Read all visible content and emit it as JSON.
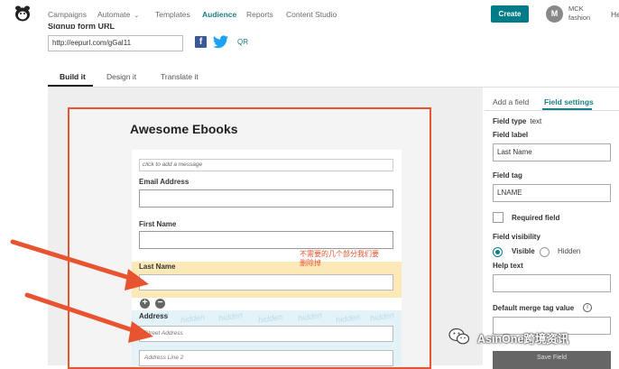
{
  "nav": {
    "items": [
      {
        "label": "Campaigns"
      },
      {
        "label": "Automate"
      },
      {
        "label": "Templates"
      },
      {
        "label": "Audience"
      },
      {
        "label": "Reports"
      },
      {
        "label": "Content Studio"
      }
    ],
    "create_label": "Create",
    "avatar_initial": "M",
    "account_line1": "MCK",
    "account_line2": "fashion",
    "help_label": "He"
  },
  "signup": {
    "title": "Signup form URL",
    "url": "http://eepurl.com/gGal11",
    "fb_glyph": "f",
    "qr_label": "QR"
  },
  "tabs": [
    {
      "label": "Build it"
    },
    {
      "label": "Design it"
    },
    {
      "label": "Translate it"
    }
  ],
  "form": {
    "title": "Awesome Ebooks",
    "message_placeholder": "click to add a message",
    "email_label": "Email Address",
    "first_name_label": "First Name",
    "last_name_label": "Last Name",
    "address_label": "Address",
    "street_placeholder": "Street Address",
    "line2_placeholder": "Address Line 2",
    "hidden_word": "hidden",
    "add_glyph": "+",
    "remove_glyph": "−"
  },
  "annotation": {
    "line1": "不需要的几个部分我们要",
    "line2": "删除掉"
  },
  "panel": {
    "tab_add": "Add a field",
    "tab_settings": "Field settings",
    "field_type_label": "Field type",
    "field_type_value": "text",
    "field_label_label": "Field label",
    "field_label_value": "Last Name",
    "field_tag_label": "Field tag",
    "field_tag_value": "LNAME",
    "required_label": "Required field",
    "visibility_label": "Field visibility",
    "visible_label": "Visible",
    "hidden_label": "Hidden",
    "help_text_label": "Help text",
    "merge_label": "Default merge tag value",
    "info_glyph": "i",
    "save_label": "Save Field"
  },
  "watermark": {
    "text": "AsinOne跨境资讯"
  },
  "colors": {
    "accent": "#007c89",
    "annotation": "#e8542f",
    "lastname_highlight": "#fde9b8",
    "hidden_highlight": "#e4f3f8"
  }
}
